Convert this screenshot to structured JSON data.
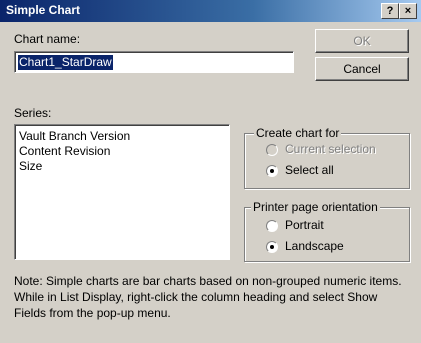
{
  "window": {
    "title": "Simple Chart",
    "help_label": "?",
    "close_label": "×"
  },
  "chart_name": {
    "label": "Chart name:",
    "value": "Chart1_StarDraw"
  },
  "buttons": {
    "ok": "OK",
    "cancel": "Cancel"
  },
  "series": {
    "label": "Series:",
    "items": [
      "Vault Branch Version",
      "Content Revision",
      "Size"
    ]
  },
  "create_chart_for": {
    "legend": "Create chart for",
    "options": [
      {
        "label": "Current selection",
        "selected": false,
        "enabled": false
      },
      {
        "label": "Select all",
        "selected": true,
        "enabled": true
      }
    ]
  },
  "orientation": {
    "legend": "Printer page orientation",
    "options": [
      {
        "label": "Portrait",
        "selected": false,
        "enabled": true
      },
      {
        "label": "Landscape",
        "selected": true,
        "enabled": true
      }
    ]
  },
  "note": "Note: Simple charts are bar charts based on non-grouped numeric items.  While in List Display, right-click the column heading and select Show Fields from the pop-up menu."
}
